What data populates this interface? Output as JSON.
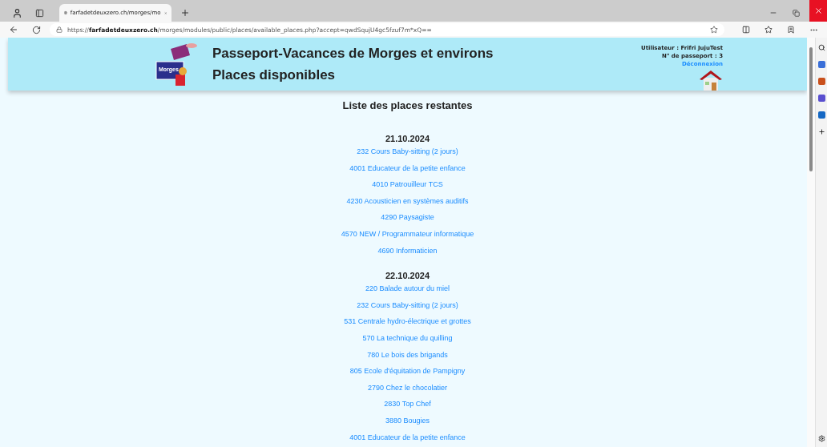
{
  "browser": {
    "tab": {
      "title": "farfadetdeuxzero.ch/morges/mo"
    },
    "address": {
      "url": "https://**farfadetdeuxzero.ch**/morges/modules/public/places/available_places.php?accept=qwdSqujU4gc5fzuf7m*xQ=="
    }
  },
  "header": {
    "logo_text": "Morges",
    "title": "Passeport-Vacances de Morges et environs",
    "subtitle": "Places disponibles",
    "user": "Utilisateur : Frifri JujuTest",
    "passport": "N° de passeport : 3",
    "logout": "Déconnexion"
  },
  "list_title": "Liste des places restantes",
  "days": [
    {
      "date": "21.10.2024",
      "places": [
        "232 Cours Baby-sitting (2 jours)",
        "4001 Educateur de la petite enfance",
        "4010 Patrouilleur TCS",
        "4230 Acousticien en systèmes auditifs",
        "4290 Paysagiste",
        "4570 NEW / Programmateur informatique",
        "4690 Informaticien"
      ]
    },
    {
      "date": "22.10.2024",
      "places": [
        "220 Balade autour du miel",
        "232 Cours Baby-sitting (2 jours)",
        "531 Centrale hydro-électrique et grottes",
        "570 La technique du quilling",
        "780 Le bois des brigands",
        "805 Ecole d'équitation de Pampigny",
        "2790 Chez le chocolatier",
        "2830 Top Chef",
        "3880 Bougies",
        "4001 Educateur de la petite enfance"
      ]
    }
  ]
}
